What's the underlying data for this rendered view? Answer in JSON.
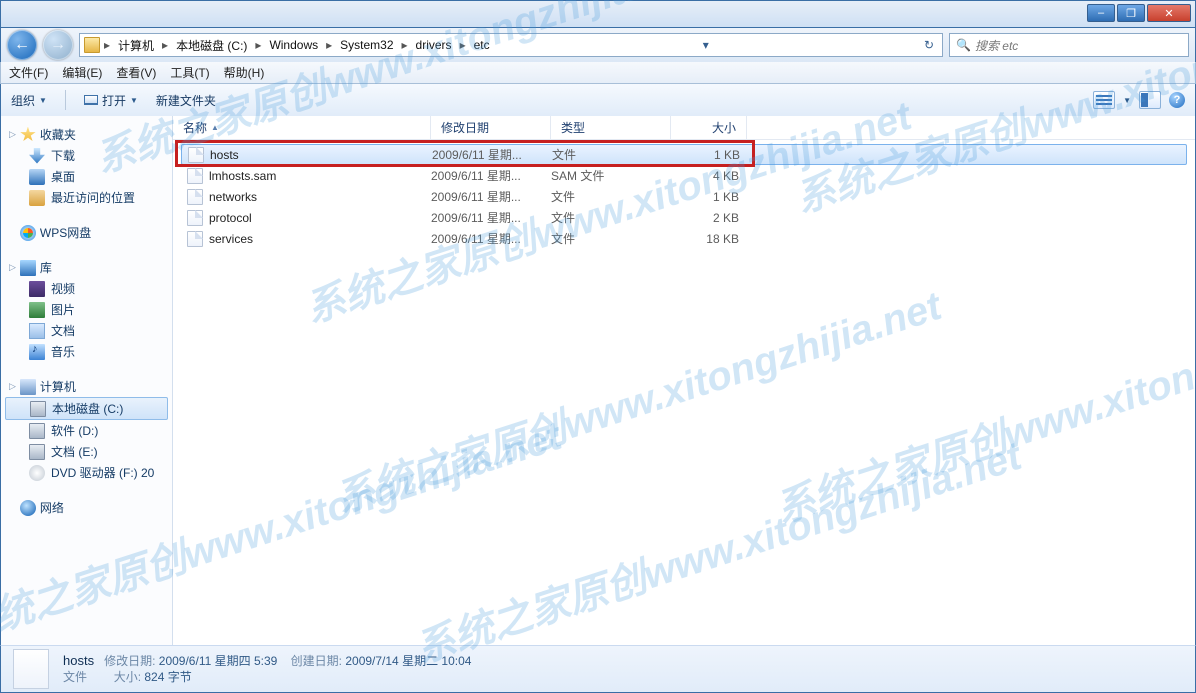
{
  "window": {
    "min": "–",
    "max": "❐",
    "close": "✕"
  },
  "nav": {
    "crumbs": [
      "计算机",
      "本地磁盘 (C:)",
      "Windows",
      "System32",
      "drivers",
      "etc"
    ],
    "search_placeholder": "搜索 etc"
  },
  "menu": {
    "file": "文件(F)",
    "edit": "编辑(E)",
    "view": "查看(V)",
    "tools": "工具(T)",
    "help": "帮助(H)"
  },
  "toolbar": {
    "organize": "组织",
    "open": "打开",
    "newfolder": "新建文件夹"
  },
  "sidebar": {
    "favorites": "收藏夹",
    "fav_items": [
      "下载",
      "桌面",
      "最近访问的位置"
    ],
    "wps": "WPS网盘",
    "libraries": "库",
    "lib_items": [
      "视频",
      "图片",
      "文档",
      "音乐"
    ],
    "computer": "计算机",
    "drives": [
      "本地磁盘 (C:)",
      "软件 (D:)",
      "文档 (E:)",
      "DVD 驱动器 (F:) 20"
    ],
    "network": "网络"
  },
  "columns": {
    "name": "名称",
    "date": "修改日期",
    "type": "类型",
    "size": "大小"
  },
  "files": [
    {
      "name": "hosts",
      "date": "2009/6/11 星期...",
      "type": "文件",
      "size": "1 KB",
      "sel": true
    },
    {
      "name": "lmhosts.sam",
      "date": "2009/6/11 星期...",
      "type": "SAM 文件",
      "size": "4 KB"
    },
    {
      "name": "networks",
      "date": "2009/6/11 星期...",
      "type": "文件",
      "size": "1 KB"
    },
    {
      "name": "protocol",
      "date": "2009/6/11 星期...",
      "type": "文件",
      "size": "2 KB"
    },
    {
      "name": "services",
      "date": "2009/6/11 星期...",
      "type": "文件",
      "size": "18 KB"
    }
  ],
  "details": {
    "name": "hosts",
    "mlabel": "修改日期:",
    "mval": "2009/6/11 星期四 5:39",
    "clabel": "创建日期:",
    "cval": "2009/7/14 星期二 10:04",
    "typelabel": "文件",
    "slabel": "大小:",
    "sval": "824 字节"
  },
  "watermark": "系统之家原创www.xitongzhijia.net"
}
